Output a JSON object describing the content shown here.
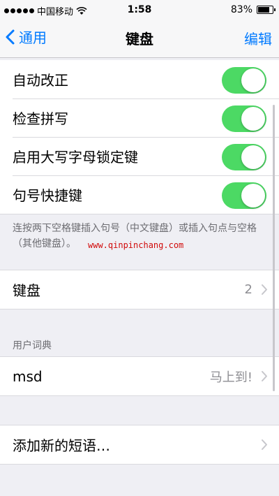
{
  "status_bar": {
    "carrier": "中国移动",
    "time": "1:58",
    "battery": "83%",
    "battery_level": 0.83,
    "signal_icon": "signal-dots-icon",
    "wifi_icon": "wifi-icon"
  },
  "nav": {
    "back_label": "通用",
    "title": "键盘",
    "edit_label": "编辑"
  },
  "toggles": [
    {
      "label": "自动改正",
      "on": true
    },
    {
      "label": "检查拼写",
      "on": true
    },
    {
      "label": "启用大写字母锁定键",
      "on": true
    },
    {
      "label": "句号快捷键",
      "on": true
    }
  ],
  "toggle_footer": "连按两下空格键插入句号（中文键盘）或插入句点与空格（其他键盘）。",
  "watermark": "www.qinpinchang.com",
  "keyboards": {
    "label": "键盘",
    "value": "2"
  },
  "user_dictionary": {
    "header": "用户词典",
    "entries": [
      {
        "shortcut": "msd",
        "phrase": "马上到!"
      }
    ]
  },
  "add_phrase": {
    "label": "添加新的短语…"
  },
  "colors": {
    "accent": "#007aff",
    "switch_on": "#4cd964",
    "background": "#efeff4"
  }
}
